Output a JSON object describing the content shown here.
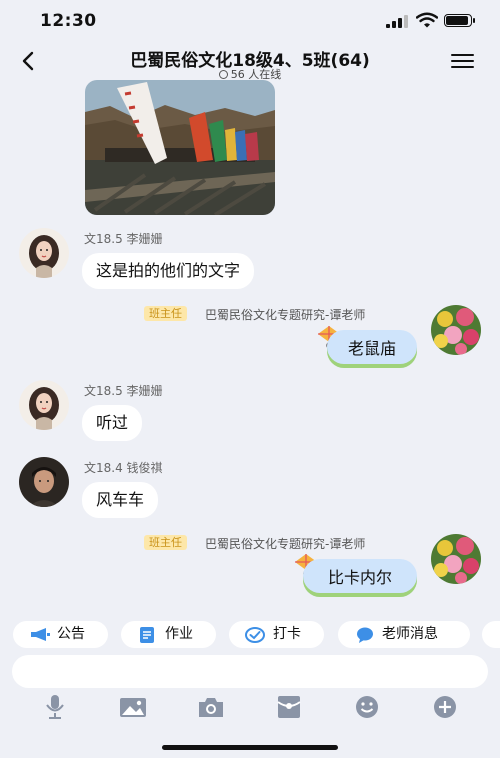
{
  "status_bar": {
    "time": "12:30"
  },
  "header": {
    "title": "巴蜀民俗文化18级4、5班(64)",
    "online": "56 人在线"
  },
  "messages": [
    {
      "type": "image",
      "side": "left"
    },
    {
      "side": "left",
      "sender": "文18.5 李姗姗",
      "text": "这是拍的他们的文字"
    },
    {
      "side": "right",
      "role": "班主任",
      "sender": "巴蜀民俗文化专题研究-谭老师",
      "text": "老鼠庙"
    },
    {
      "side": "left",
      "sender": "文18.5 李姗姗",
      "text": "听过"
    },
    {
      "side": "left",
      "sender": "文18.4 钱俊祺",
      "text": "风车车"
    },
    {
      "side": "right",
      "role": "班主任",
      "sender": "巴蜀民俗文化专题研究-谭老师",
      "text": "比卡内尔"
    }
  ],
  "quick_actions": [
    {
      "label": "公告",
      "icon": "megaphone-icon"
    },
    {
      "label": "作业",
      "icon": "document-icon"
    },
    {
      "label": "打卡",
      "icon": "check-icon"
    },
    {
      "label": "老师消息",
      "icon": "chat-icon"
    }
  ],
  "toolbar": [
    "microphone-icon",
    "image-icon",
    "camera-icon",
    "red-envelope-icon",
    "emoji-icon",
    "plus-icon"
  ],
  "colors": {
    "background": "#eef0f6",
    "bubble_left": "#ffffff",
    "bubble_right": "#cfe4fb",
    "badge_bg": "#fde7a9",
    "badge_text": "#c9931a",
    "accent": "#3d8fe6"
  }
}
